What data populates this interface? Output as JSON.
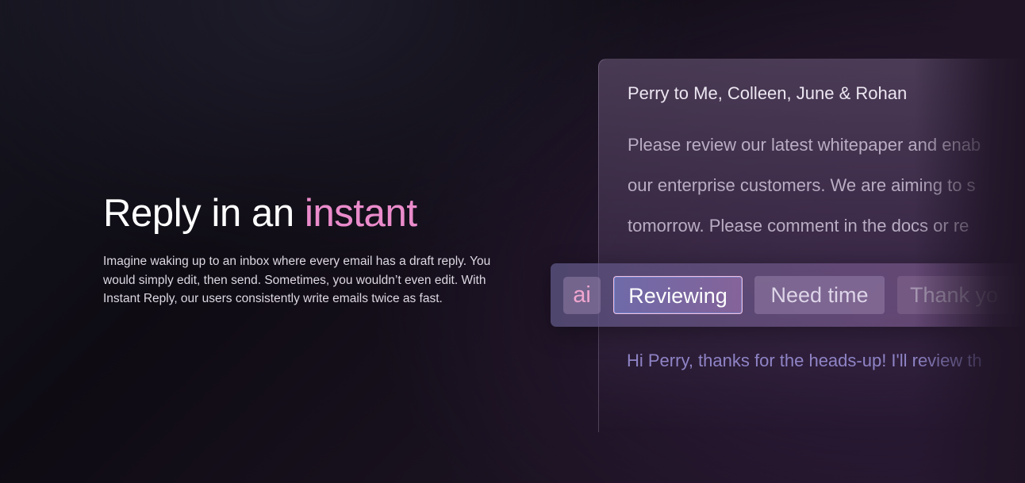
{
  "hero": {
    "title_prefix": "Reply in an ",
    "title_accent": "instant",
    "description": "Imagine waking up to an inbox where every email has a draft reply. You would simply edit, then send. Sometimes, you wouldn’t even edit.  With Instant Reply, our users consistently write emails twice as fast."
  },
  "email": {
    "from": "Perry to Me, Colleen, June & Rohan",
    "body_lines": [
      "Please review our latest whitepaper and enab",
      "our enterprise customers. We are aiming to s",
      "tomorrow.  Please comment in the docs or re"
    ],
    "draft_reply": "Hi Perry, thanks for the heads-up!  I'll review th"
  },
  "suggestions": {
    "badge": "ai",
    "chips": [
      "Reviewing",
      "Need time",
      "Thank yo"
    ]
  },
  "colors": {
    "accent_pink": "#ea8bcb",
    "reply_text": "#8f84c6",
    "background": "#15101b"
  }
}
